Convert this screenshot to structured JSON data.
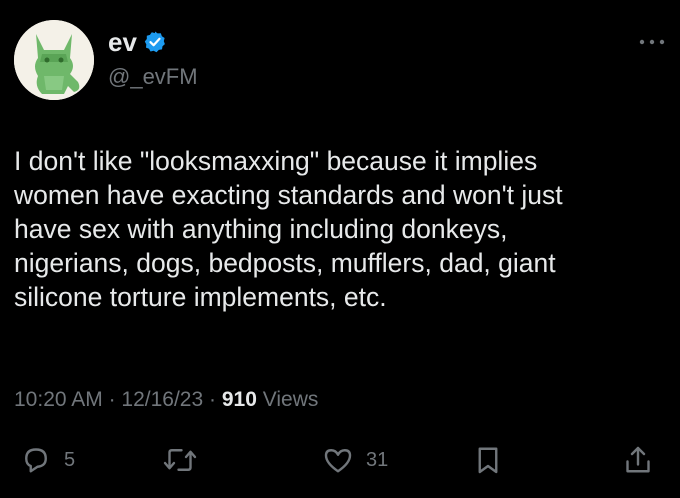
{
  "user": {
    "display_name": "ev",
    "handle": "@_evFM",
    "verified": true
  },
  "tweet": {
    "text": "I don't like \"looksmaxxing\" because it implies\nwomen have exacting standards and won't just\nhave sex with anything including donkeys,\nnigerians, dogs, bedposts, mufflers, dad, giant\nsilicone torture implements, etc."
  },
  "meta": {
    "time": "10:20 AM",
    "separator": "·",
    "date": "12/16/23",
    "views_count": "910",
    "views_label": "Views"
  },
  "actions": {
    "replies": "5",
    "reposts": "",
    "likes": "31"
  },
  "colors": {
    "background": "#000000",
    "text": "#e7e9ea",
    "muted": "#71767b",
    "verified": "#1d9bf0"
  },
  "icons": [
    "more-icon",
    "verified-icon",
    "reply-icon",
    "repost-icon",
    "like-icon",
    "bookmark-icon",
    "share-icon"
  ]
}
